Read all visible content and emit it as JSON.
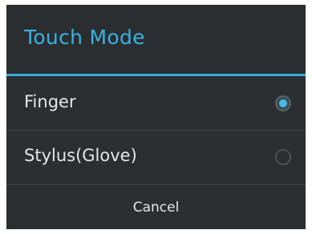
{
  "dialog": {
    "title": "Touch Mode",
    "options": [
      {
        "label": "Finger",
        "selected": true
      },
      {
        "label": "Stylus(Glove)",
        "selected": false
      }
    ],
    "cancel_label": "Cancel"
  },
  "colors": {
    "accent": "#35a8db",
    "background": "#2b2f31",
    "text": "#e6e6e6"
  }
}
